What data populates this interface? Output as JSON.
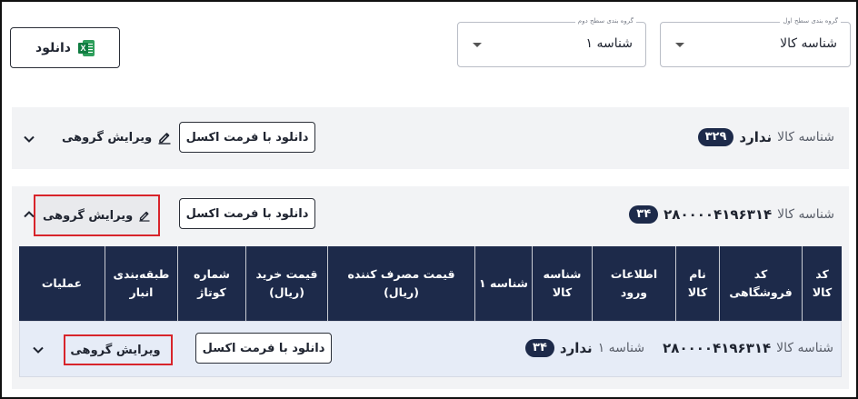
{
  "filters": {
    "level1": {
      "legend": "گروه بندی سطح اول",
      "value": "شناسه کالا"
    },
    "level2": {
      "legend": "گروه بندی سطح دوم",
      "value": "شناسه ۱"
    }
  },
  "main_download_label": "دانلود",
  "groups": [
    {
      "field": "شناسه کالا",
      "value": "ندارد",
      "count": "۳۲۹",
      "excel_label": "دانلود با فرمت اکسل",
      "edit_label": "ویرایش گروهی"
    },
    {
      "field": "شناسه کالا",
      "value": "۲۸۰۰۰۰۴۱۹۶۳۱۴",
      "count": "۳۴",
      "excel_label": "دانلود با فرمت اکسل",
      "edit_label": "ویرایش گروهی",
      "table_headers": [
        "کد کالا",
        "کد فروشگاهی",
        "نام کالا",
        "اطلاعات ورود",
        "شناسه کالا",
        "شناسه ۱",
        "قیمت مصرف کننده (ریال)",
        "قیمت خرید (ریال)",
        "شماره کوتاژ",
        "طبقه‌بندی انبار",
        "عملیات"
      ],
      "subgroup": {
        "field": "شناسه کالا",
        "value": "۲۸۰۰۰۰۴۱۹۶۳۱۴",
        "field2": "شناسه ۱",
        "value2": "ندارد",
        "count": "۳۴",
        "excel_label": "دانلود با فرمت اکسل",
        "edit_label": "ویرایش گروهی"
      }
    }
  ],
  "colors": {
    "header_bg": "#1d2a4a",
    "highlight": "#d8242b",
    "excel_green": "#107c41"
  }
}
